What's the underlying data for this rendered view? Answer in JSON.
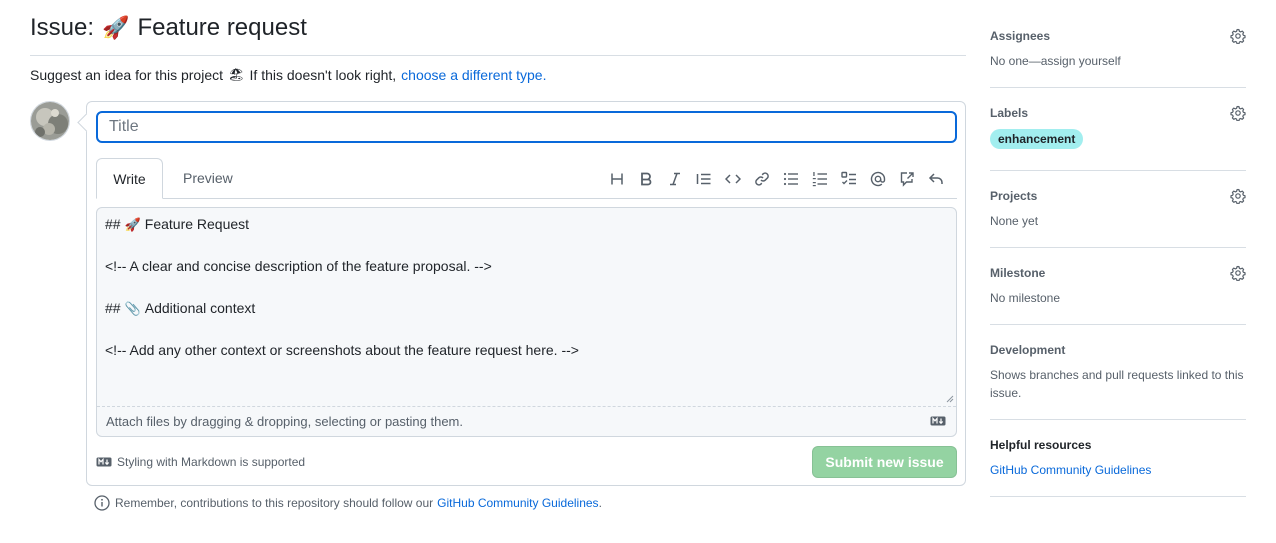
{
  "header": {
    "title_prefix": "Issue:",
    "title_emoji": "🚀",
    "title": "Feature request",
    "suggest_text": "Suggest an idea for this project",
    "suggest_emoji": "🏖",
    "wrong_type_text": "If this doesn't look right,",
    "wrong_type_link": "choose a different type."
  },
  "form": {
    "title_placeholder": "Title",
    "tabs": {
      "write": "Write",
      "preview": "Preview"
    },
    "toolbar": [
      {
        "name": "heading-icon"
      },
      {
        "name": "bold-icon"
      },
      {
        "name": "italic-icon"
      },
      {
        "name": "quote-icon"
      },
      {
        "name": "code-icon"
      },
      {
        "name": "link-icon"
      },
      {
        "name": "unordered-list-icon"
      },
      {
        "name": "ordered-list-icon"
      },
      {
        "name": "task-list-icon"
      },
      {
        "name": "mention-icon"
      },
      {
        "name": "cross-reference-icon"
      },
      {
        "name": "reply-icon"
      }
    ],
    "body": {
      "line1_prefix": "##",
      "line1_emoji": "🚀",
      "line1_text": "Feature Request",
      "line2": "<!-- A clear and concise description of the feature proposal. -->",
      "line3_prefix": "##",
      "line3_emoji": "📎",
      "line3_text": "Additional context",
      "line4": "<!-- Add any other context or screenshots about the feature request here. -->"
    },
    "attach_text": "Attach files by dragging & dropping, selecting or pasting them.",
    "markdown_note": "Styling with Markdown is supported",
    "submit_label": "Submit new issue"
  },
  "footer": {
    "remember_text": "Remember, contributions to this repository should follow our",
    "guidelines_link": "GitHub Community Guidelines",
    "period": "."
  },
  "sidebar": {
    "assignees": {
      "heading": "Assignees",
      "value": "No one—assign yourself"
    },
    "labels": {
      "heading": "Labels",
      "label": "enhancement"
    },
    "projects": {
      "heading": "Projects",
      "value": "None yet"
    },
    "milestone": {
      "heading": "Milestone",
      "value": "No milestone"
    },
    "development": {
      "heading": "Development",
      "value": "Shows branches and pull requests linked to this issue."
    },
    "resources": {
      "heading": "Helpful resources",
      "link": "GitHub Community Guidelines"
    }
  },
  "colors": {
    "accent": "#0969da",
    "label_bg": "#a2eeef",
    "submit_disabled": "#94d3a2"
  }
}
